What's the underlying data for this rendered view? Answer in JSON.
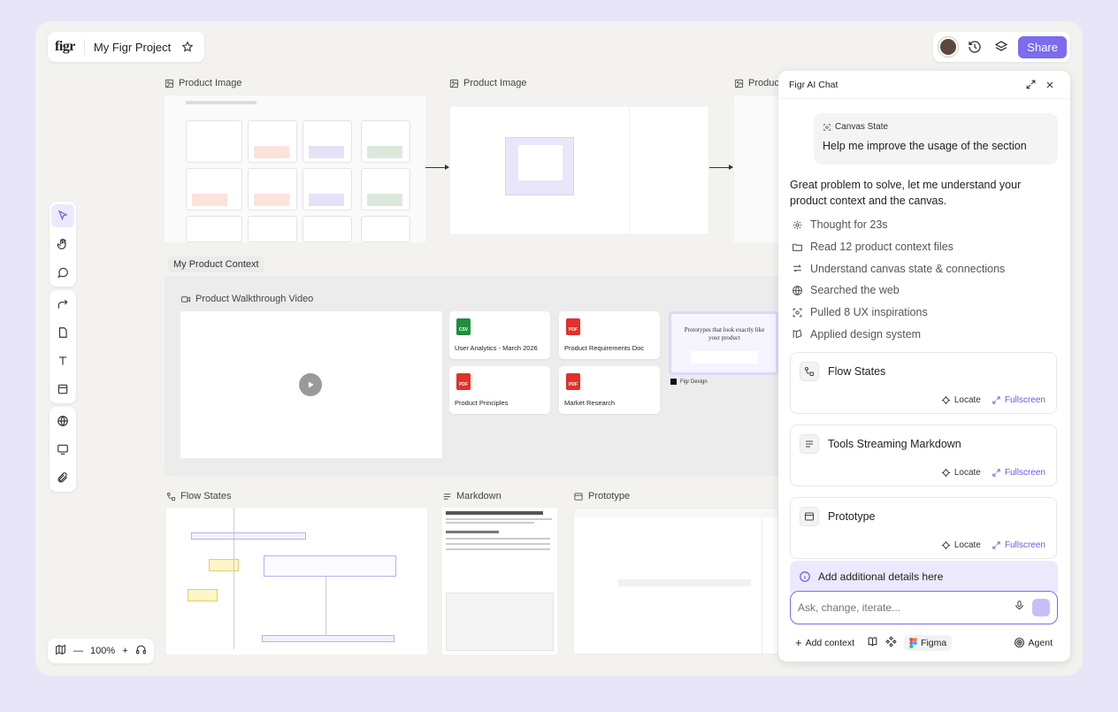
{
  "app": {
    "logo": "figr",
    "project_name": "My Figr Project"
  },
  "top": {
    "share_label": "Share"
  },
  "zoom": {
    "level": "100%"
  },
  "frames": {
    "product_image_1": "Product Image",
    "product_image_2": "Product Image",
    "product_image_3": "Product Image",
    "context_tag": "My Product Context",
    "walkthrough": "Product Walkthrough Video",
    "flow_states": "Flow States",
    "markdown": "Markdown",
    "prototype": "Prototype"
  },
  "files": [
    {
      "name": "User Analytics - March 2026",
      "type": "CSV",
      "color": "#1e8e3e"
    },
    {
      "name": "Product Requirements Doc",
      "type": "PDF",
      "color": "#e0312a"
    },
    {
      "name": "Product Principles",
      "type": "PDF",
      "color": "#e0312a"
    },
    {
      "name": "Market Research",
      "type": "PDF",
      "color": "#e0312a"
    }
  ],
  "preview_card": {
    "headline": "Prototypes that look exactly like your product",
    "brand": "Figr Design"
  },
  "chat": {
    "title": "Figr AI Chat",
    "user_tag": "Canvas State",
    "user_message": "Help me improve the usage of the section",
    "reply": "Great problem to solve, let me understand your product context and the canvas.",
    "steps": [
      {
        "icon": "thought-icon",
        "label": "Thought for 23s"
      },
      {
        "icon": "folder-icon",
        "label": "Read 12 product context files"
      },
      {
        "icon": "arrows-icon",
        "label": "Understand canvas state & connections"
      },
      {
        "icon": "globe-icon",
        "label": "Searched the web"
      },
      {
        "icon": "scan-icon",
        "label": "Pulled 8 UX inspirations"
      },
      {
        "icon": "palette-icon",
        "label": "Applied design system"
      }
    ],
    "results": [
      {
        "title": "Flow States",
        "locate": "Locate",
        "fullscreen": "Fullscreen"
      },
      {
        "title": "Tools Streaming Markdown",
        "locate": "Locate",
        "fullscreen": "Fullscreen"
      },
      {
        "title": "Prototype",
        "locate": "Locate",
        "fullscreen": "Fullscreen"
      }
    ],
    "additional": "Add additional details here",
    "input_placeholder": "Ask, change, iterate...",
    "add_context": "Add context",
    "figma": "Figma",
    "agent": "Agent"
  },
  "colors": {
    "accent": "#7b6cf0",
    "canvas": "#f3f2ef",
    "page": "#e8e5f8"
  }
}
